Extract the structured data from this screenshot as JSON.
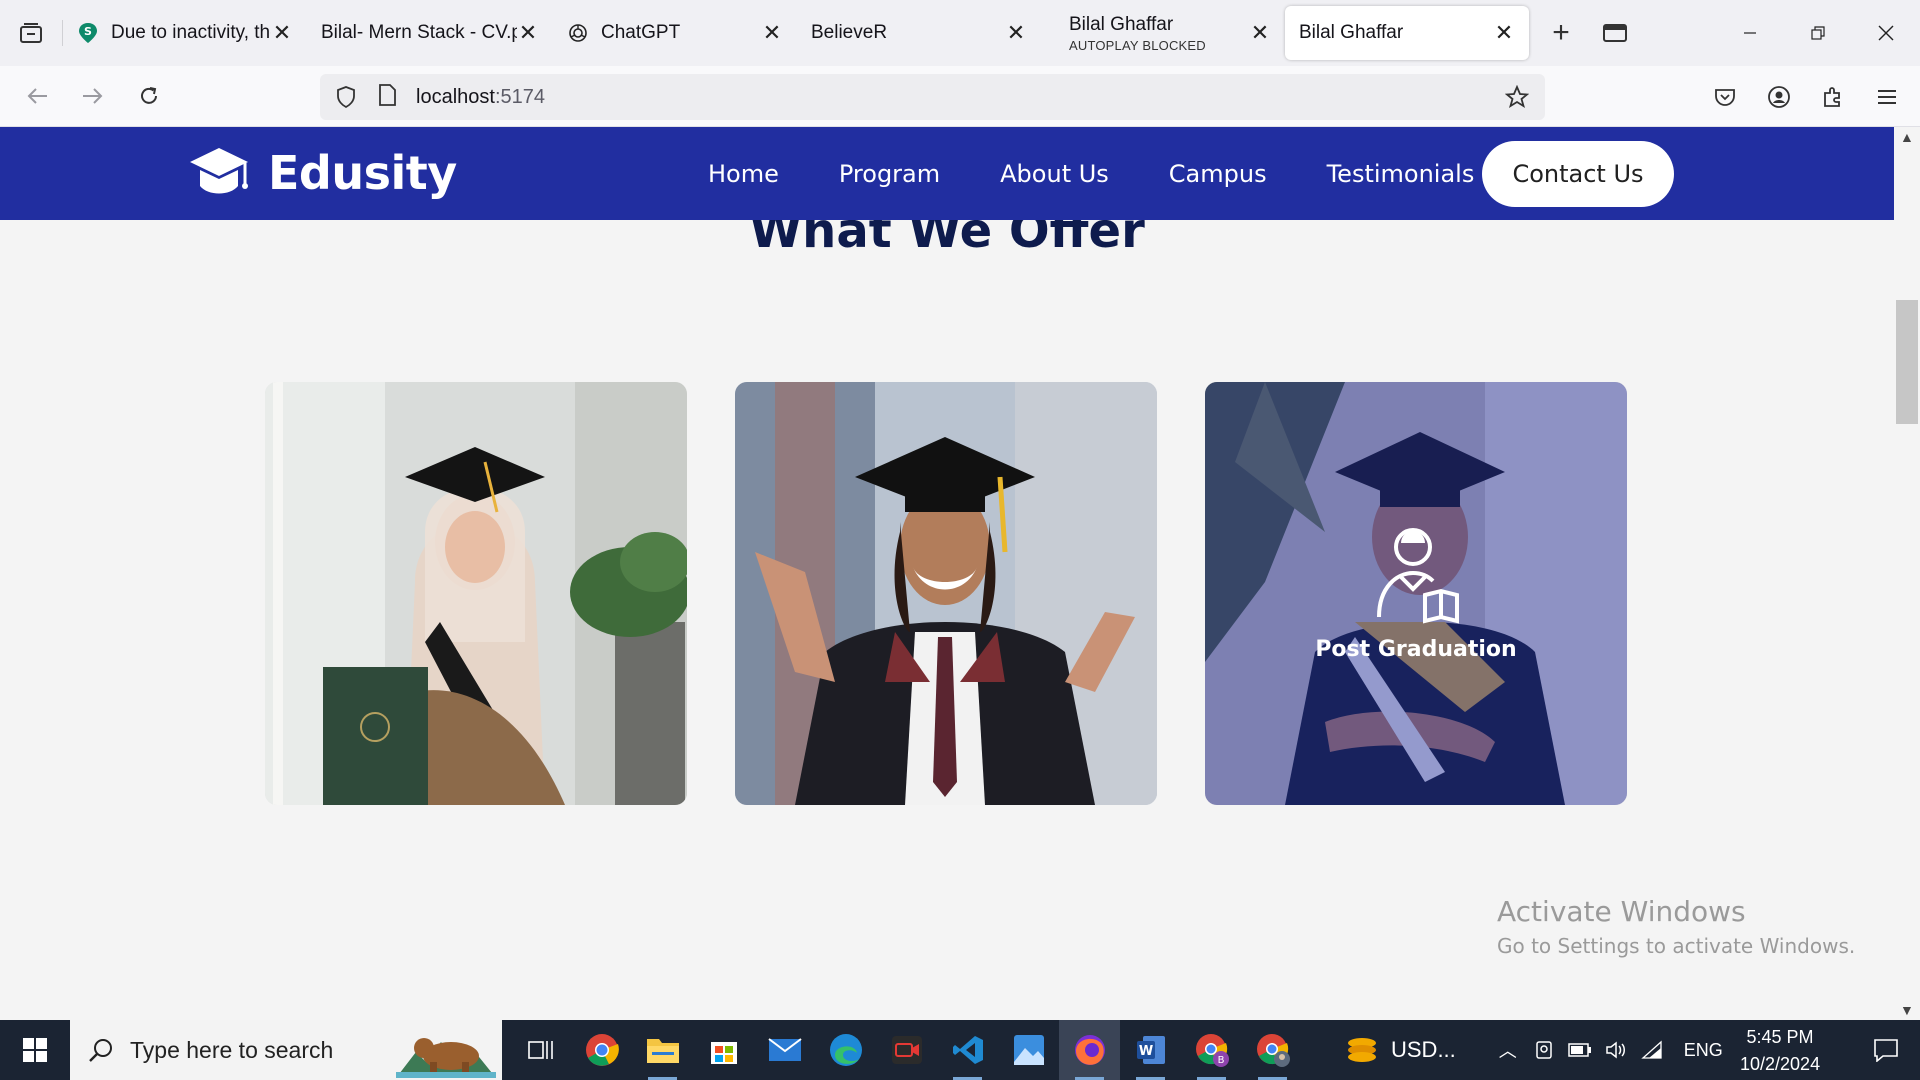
{
  "browser": {
    "tabs": [
      {
        "title": "Due to inactivity, the",
        "subtitle": "",
        "favicon": "green-s-icon",
        "active": false
      },
      {
        "title": "Bilal- Mern Stack - CV.p",
        "subtitle": "",
        "favicon": "none",
        "active": false
      },
      {
        "title": "ChatGPT",
        "subtitle": "",
        "favicon": "chatgpt-icon",
        "active": false
      },
      {
        "title": "BelieveR",
        "subtitle": "",
        "favicon": "none",
        "active": false
      },
      {
        "title": "Bilal Ghaffar",
        "subtitle": "AUTOPLAY BLOCKED",
        "favicon": "none",
        "active": false
      },
      {
        "title": "Bilal Ghaffar",
        "subtitle": "",
        "favicon": "none",
        "active": true
      }
    ],
    "url_host": "localhost",
    "url_port": ":5174"
  },
  "site": {
    "brand": "Edusity",
    "nav": [
      "Home",
      "Program",
      "About Us",
      "Campus",
      "Testimonials"
    ],
    "contact_label": "Contact Us",
    "section_title": "What We Offer",
    "cards": [
      {
        "caption": "",
        "photo": "graduate-woman-hijab"
      },
      {
        "caption": "",
        "photo": "graduate-man-smiling"
      },
      {
        "caption": "Post Graduation",
        "photo": "graduate-man-sash"
      }
    ],
    "accent_color": "#212ea0"
  },
  "watermark": {
    "line1": "Activate Windows",
    "line2": "Go to Settings to activate Windows."
  },
  "taskbar": {
    "search_placeholder": "Type here to search",
    "apps": [
      "task-view",
      "chrome",
      "file-explorer",
      "microsoft-store",
      "mail",
      "edge",
      "camera-app",
      "vscode",
      "photos",
      "firefox",
      "word",
      "chrome-profile-b",
      "chrome-profile-2"
    ],
    "ticker": "USD...",
    "language": "ENG",
    "time": "5:45 PM",
    "date": "10/2/2024"
  }
}
